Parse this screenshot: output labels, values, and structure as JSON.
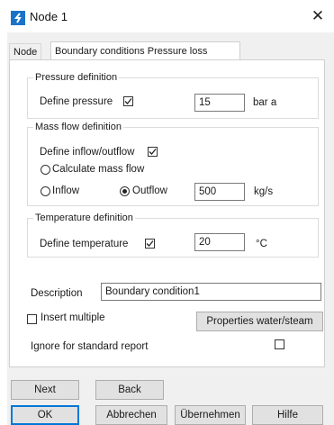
{
  "window": {
    "title": "Node 1",
    "close_glyph": "✕"
  },
  "tabs": [
    {
      "label": "Node"
    },
    {
      "label": "Boundary conditions Pressure loss"
    }
  ],
  "pressure": {
    "legend": "Pressure definition",
    "define_label": "Define pressure",
    "checked": true,
    "value": "15",
    "unit": "bar a"
  },
  "mass_flow": {
    "legend": "Mass flow definition",
    "define_label": "Define inflow/outflow",
    "checked": true,
    "calc_label": "Calculate mass flow",
    "inflow_label": "Inflow",
    "outflow_label": "Outflow",
    "selected": "Outflow",
    "value": "500",
    "unit": "kg/s"
  },
  "temperature": {
    "legend": "Temperature definition",
    "define_label": "Define temperature",
    "checked": true,
    "value": "20",
    "unit": "°C"
  },
  "description": {
    "label": "Description",
    "value": "Boundary condition1"
  },
  "insert_multiple": {
    "label": "Insert multiple",
    "checked": false
  },
  "properties_button": "Properties water/steam",
  "ignore_report": {
    "label": "Ignore for standard report",
    "checked": false
  },
  "buttons": {
    "next": "Next",
    "back": "Back",
    "ok": "OK",
    "cancel": "Abbrechen",
    "apply": "Übernehmen",
    "help": "Hilfe"
  },
  "colors": {
    "accent": "#0078d7",
    "app_icon": "#1a73c8",
    "dialog_bg": "#f0f0f0"
  },
  "icons": {
    "app": "app-logo-icon",
    "check": "checkmark-icon",
    "close": "close-icon"
  }
}
